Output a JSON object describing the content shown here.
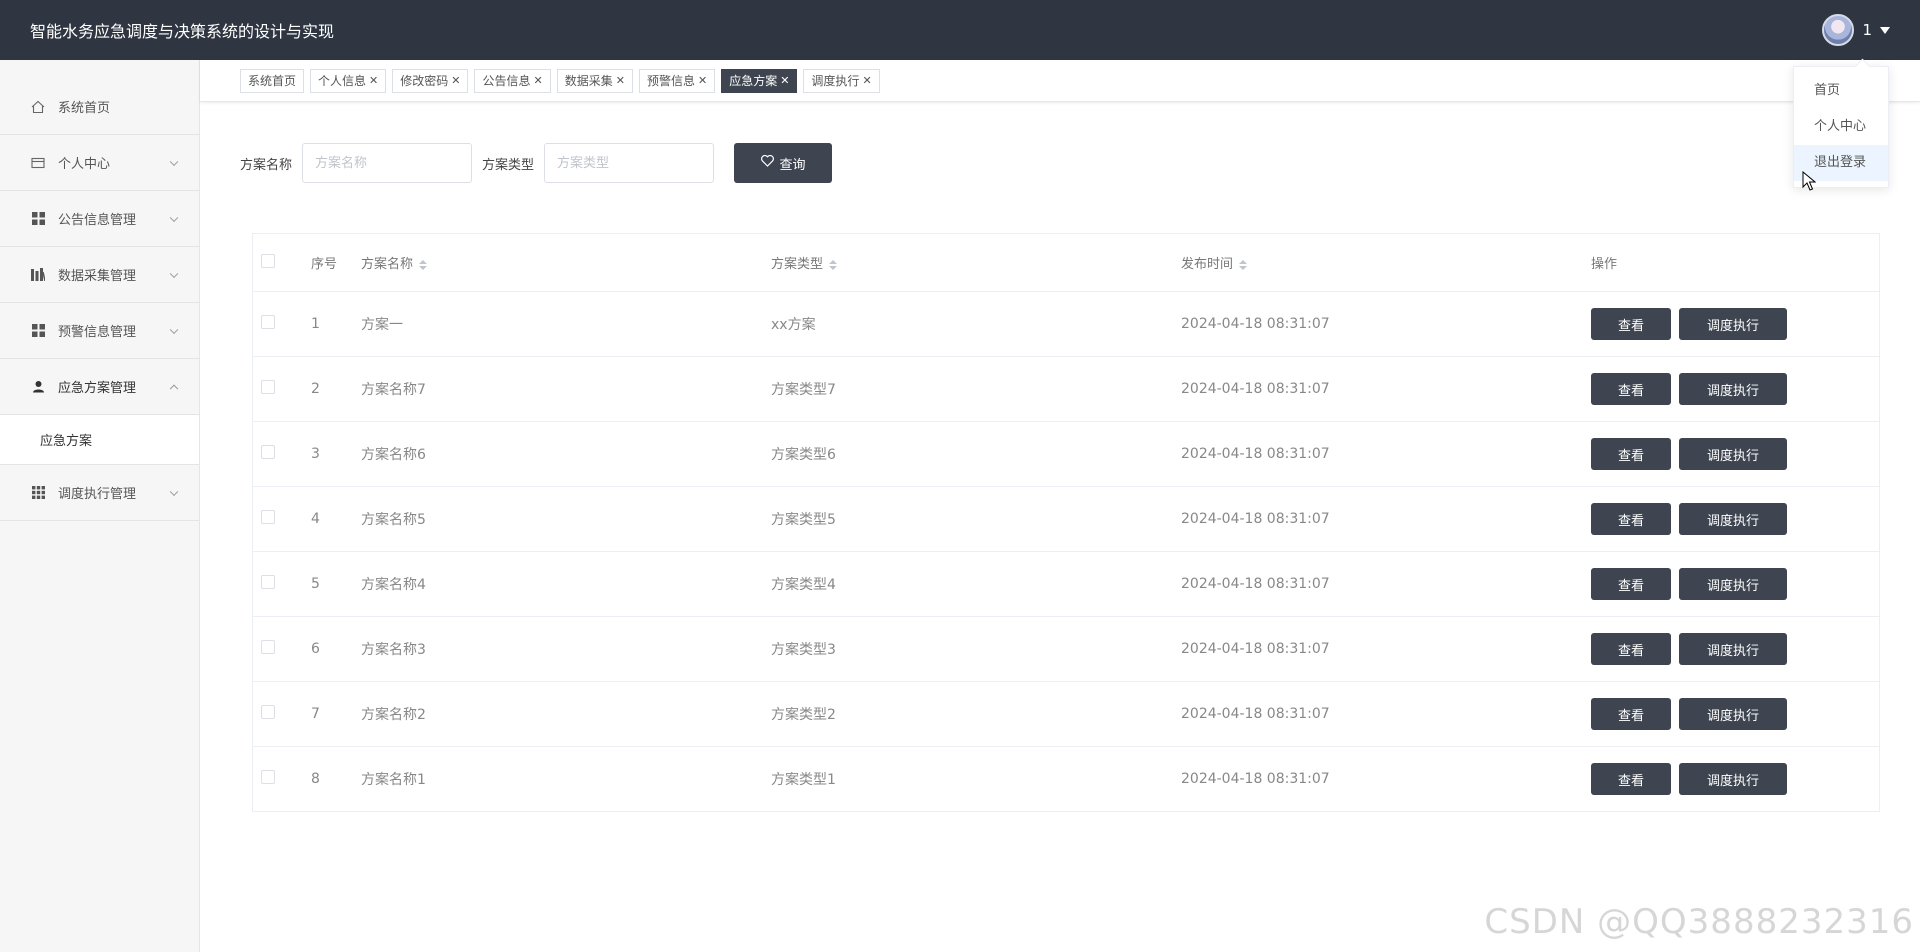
{
  "header": {
    "title": "智能水务应急调度与决策系统的设计与实现",
    "user_name": "1"
  },
  "user_menu": {
    "items": [
      "首页",
      "个人中心",
      "退出登录"
    ]
  },
  "sidebar": {
    "items": [
      {
        "label": "系统首页",
        "icon": "home-icon"
      },
      {
        "label": "个人中心",
        "icon": "card-icon"
      },
      {
        "label": "公告信息管理",
        "icon": "grid-icon"
      },
      {
        "label": "数据采集管理",
        "icon": "chart-icon"
      },
      {
        "label": "预警信息管理",
        "icon": "grid-icon"
      },
      {
        "label": "应急方案管理",
        "icon": "user-icon"
      },
      {
        "label": "调度执行管理",
        "icon": "apps-icon"
      }
    ],
    "sub_item": "应急方案"
  },
  "tags": [
    "系统首页",
    "个人信息",
    "修改密码",
    "公告信息",
    "数据采集",
    "预警信息",
    "应急方案",
    "调度执行"
  ],
  "search": {
    "name_label": "方案名称",
    "name_placeholder": "方案名称",
    "type_label": "方案类型",
    "type_placeholder": "方案类型",
    "query_label": "查询"
  },
  "table": {
    "headers": {
      "index": "序号",
      "name": "方案名称",
      "type": "方案类型",
      "time": "发布时间",
      "ops": "操作"
    },
    "view_label": "查看",
    "exec_label": "调度执行",
    "rows": [
      {
        "index": "1",
        "name": "方案一",
        "type": "xx方案",
        "time": "2024-04-18 08:31:07"
      },
      {
        "index": "2",
        "name": "方案名称7",
        "type": "方案类型7",
        "time": "2024-04-18 08:31:07"
      },
      {
        "index": "3",
        "name": "方案名称6",
        "type": "方案类型6",
        "time": "2024-04-18 08:31:07"
      },
      {
        "index": "4",
        "name": "方案名称5",
        "type": "方案类型5",
        "time": "2024-04-18 08:31:07"
      },
      {
        "index": "5",
        "name": "方案名称4",
        "type": "方案类型4",
        "time": "2024-04-18 08:31:07"
      },
      {
        "index": "6",
        "name": "方案名称3",
        "type": "方案类型3",
        "time": "2024-04-18 08:31:07"
      },
      {
        "index": "7",
        "name": "方案名称2",
        "type": "方案类型2",
        "time": "2024-04-18 08:31:07"
      },
      {
        "index": "8",
        "name": "方案名称1",
        "type": "方案类型1",
        "time": "2024-04-18 08:31:07"
      }
    ]
  },
  "watermark": "CSDN @QQ3888232316"
}
